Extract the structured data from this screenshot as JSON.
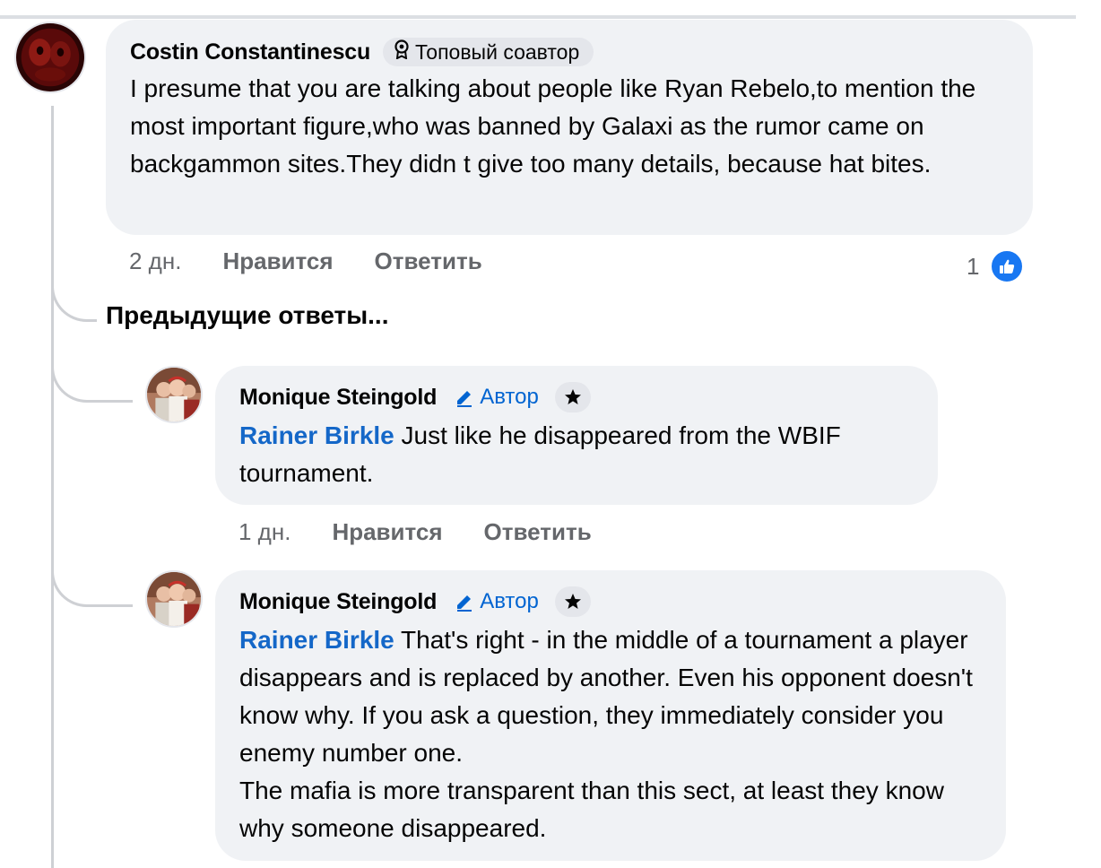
{
  "comment": {
    "author": "Costin Constantinescu",
    "badge": "Топовый соавтор",
    "text": "I presume that you are talking about people like Ryan Rebelo,to mention the most important figure,who was banned by Galaxi as the rumor came on backgammon sites.They didn t give too many details, because hat bites.",
    "time": "2 дн.",
    "like_label": "Нравится",
    "reply_label": "Ответить",
    "like_count": "1"
  },
  "previous_replies_label": "Предыдущие ответы...",
  "replies": [
    {
      "author": "Monique Steingold",
      "badge": "Автор",
      "mention": "Rainer Birkle",
      "text": " Just like he disappeared from the WBIF tournament.",
      "time": "1 дн.",
      "like_label": "Нравится",
      "reply_label": "Ответить"
    },
    {
      "author": "Monique Steingold",
      "badge": "Автор",
      "mention": "Rainer Birkle",
      "text": " That's right - in the middle of a tournament a player disappears and is replaced by another. Even his opponent doesn't know why. If you ask a question, they immediately consider you enemy number one.",
      "text2": "The mafia is more transparent than this sect, at least they know why someone disappeared."
    }
  ],
  "icons": {
    "top_contributor": "medal-icon",
    "author_badge": "pencil-icon",
    "star": "star-icon",
    "like": "thumbs-up-icon"
  },
  "colors": {
    "accent": "#1877f2",
    "mention": "#1467c8",
    "bubble": "#f0f2f5"
  }
}
